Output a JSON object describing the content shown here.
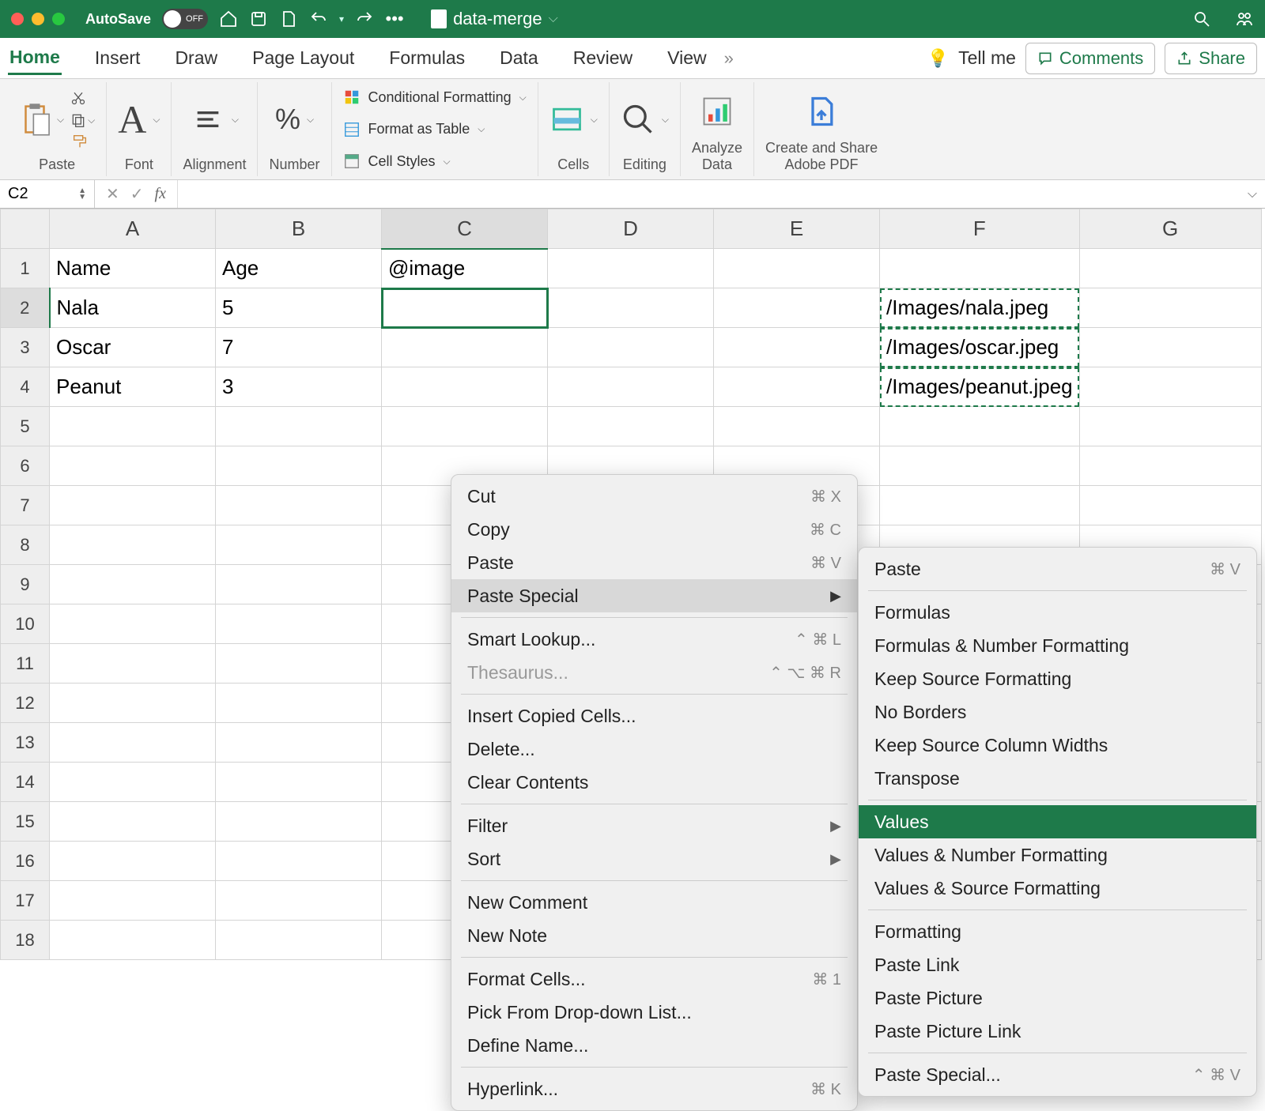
{
  "titlebar": {
    "autosave_label": "AutoSave",
    "autosave_state": "OFF",
    "filename": "data-merge"
  },
  "ribbon_tabs": {
    "home": "Home",
    "insert": "Insert",
    "draw": "Draw",
    "page_layout": "Page Layout",
    "formulas": "Formulas",
    "data": "Data",
    "review": "Review",
    "view": "View",
    "tell_me": "Tell me",
    "comments": "Comments",
    "share": "Share"
  },
  "ribbon_groups": {
    "paste": "Paste",
    "font": "Font",
    "alignment": "Alignment",
    "number": "Number",
    "cond_fmt": "Conditional Formatting",
    "fmt_table": "Format as Table",
    "cell_styles": "Cell Styles",
    "cells": "Cells",
    "editing": "Editing",
    "analyze": "Analyze Data",
    "adobe": "Create and Share Adobe PDF"
  },
  "formula_bar": {
    "namebox": "C2",
    "fx_label": "fx",
    "value": ""
  },
  "columns": [
    "A",
    "B",
    "C",
    "D",
    "E",
    "F",
    "G"
  ],
  "rows": [
    "1",
    "2",
    "3",
    "4",
    "5",
    "6",
    "7",
    "8",
    "9",
    "10",
    "11",
    "12",
    "13",
    "14",
    "15",
    "16",
    "17",
    "18"
  ],
  "cells": {
    "A1": "Name",
    "B1": "Age",
    "C1": "@image",
    "A2": "Nala",
    "B2": "5",
    "F2": "/Images/nala.jpeg",
    "A3": "Oscar",
    "B3": "7",
    "F3": "/Images/oscar.jpeg",
    "A4": "Peanut",
    "B4": "3",
    "F4": "/Images/peanut.jpeg"
  },
  "context_menu": {
    "cut": "Cut",
    "cut_key": "⌘ X",
    "copy": "Copy",
    "copy_key": "⌘ C",
    "paste": "Paste",
    "paste_key": "⌘ V",
    "paste_special": "Paste Special",
    "smart_lookup": "Smart Lookup...",
    "smart_key": "⌃ ⌘ L",
    "thesaurus": "Thesaurus...",
    "thesaurus_key": "⌃ ⌥ ⌘ R",
    "insert_copied": "Insert Copied Cells...",
    "delete": "Delete...",
    "clear": "Clear Contents",
    "filter": "Filter",
    "sort": "Sort",
    "new_comment": "New Comment",
    "new_note": "New Note",
    "format_cells": "Format Cells...",
    "format_key": "⌘ 1",
    "pick_list": "Pick From Drop-down List...",
    "define_name": "Define Name...",
    "hyperlink": "Hyperlink...",
    "hyperlink_key": "⌘ K"
  },
  "submenu": {
    "paste": "Paste",
    "paste_key": "⌘ V",
    "formulas": "Formulas",
    "formulas_num": "Formulas & Number Formatting",
    "keep_src": "Keep Source Formatting",
    "no_borders": "No Borders",
    "keep_col": "Keep Source Column Widths",
    "transpose": "Transpose",
    "values": "Values",
    "values_num": "Values & Number Formatting",
    "values_src": "Values & Source Formatting",
    "formatting": "Formatting",
    "paste_link": "Paste Link",
    "paste_pic": "Paste Picture",
    "paste_pic_link": "Paste Picture Link",
    "paste_special": "Paste Special...",
    "ps_key": "⌃ ⌘ V"
  }
}
